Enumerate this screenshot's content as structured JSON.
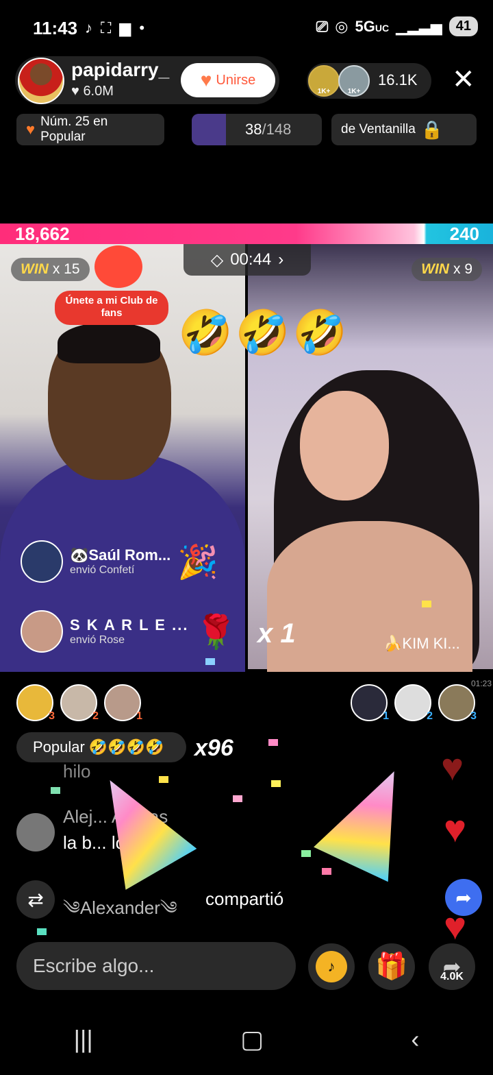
{
  "status_bar": {
    "time": "11:43",
    "network": "5G",
    "network_suffix": "UC",
    "battery": "41"
  },
  "host": {
    "name": "papidarry_",
    "likes": "6.0M",
    "join_label": "Unirse"
  },
  "viewers": {
    "badge_1": "1K+",
    "badge_2": "1K+",
    "count": "16.1K"
  },
  "chips": {
    "popular_rank": "Núm. 25 en Popular",
    "progress_current": "38",
    "progress_total": "/148",
    "location": "de Ventanilla"
  },
  "battle": {
    "score_left": "18,662",
    "score_right": "240",
    "score_left_share": 0.987,
    "timer": "00:44",
    "left_win_label": "WIN",
    "left_win_count": "x 15",
    "right_win_label": "WIN",
    "right_win_count": "x 9",
    "club_sticker": "Únete a mi Club de fans",
    "multiplier_right": "x 1",
    "right_host_name": "KIM KI..."
  },
  "gift_feed": [
    {
      "user": "Saúl Rom...",
      "action": "envió Confetí",
      "gift_icon": "confetti-cone-icon"
    },
    {
      "user": "S K A R L E ...",
      "action": "envió Rose",
      "gift_icon": "rose-icon"
    }
  ],
  "rank_left": [
    "3",
    "2",
    "1"
  ],
  "rank_right": [
    "1",
    "2",
    "3"
  ],
  "timestamp": "01:23",
  "popular_tag": "Popular",
  "popular_multiplier": "x96",
  "comments": [
    {
      "user": "",
      "text": "hilo"
    },
    {
      "user": "Alej... Arenas",
      "text": "la b... loca"
    }
  ],
  "share_event": {
    "user": "༄Alexander༄",
    "action": "compartió"
  },
  "input": {
    "placeholder": "Escribe algo..."
  },
  "share_count": "4.0K",
  "colors": {
    "battle_left": "#ff2d7a",
    "battle_right": "#19b3dc",
    "accent_orange": "#ff5a3c",
    "heart_red": "#e0202a"
  }
}
